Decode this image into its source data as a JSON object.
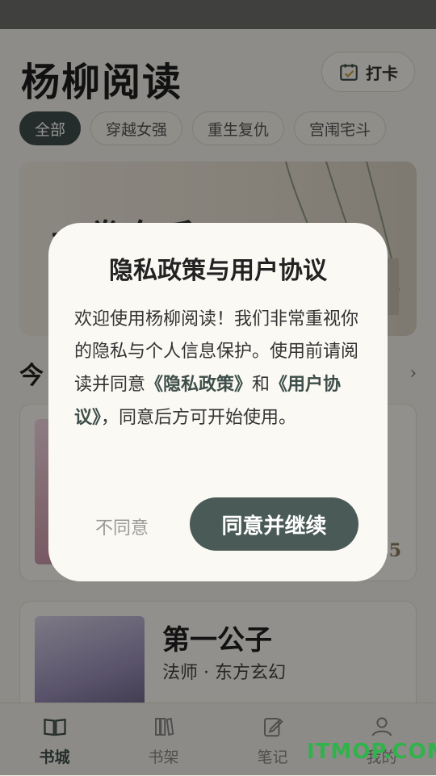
{
  "app": {
    "title": "杨柳阅读"
  },
  "checkin": {
    "label": "打卡"
  },
  "categories": [
    "全部",
    "穿越女强",
    "重生复仇",
    "宫闱宅斗"
  ],
  "banner": {
    "text": "一卷东千"
  },
  "section": {
    "title": "今"
  },
  "books": [
    {
      "title": "",
      "meta": "",
      "score": ".5"
    },
    {
      "title": "第一公子",
      "meta": "法师 · 东方玄幻"
    }
  ],
  "tabs": [
    {
      "label": "书城",
      "icon": "book-open-icon"
    },
    {
      "label": "书架",
      "icon": "bookshelf-icon"
    },
    {
      "label": "笔记",
      "icon": "note-icon"
    },
    {
      "label": "我的",
      "icon": "user-icon"
    }
  ],
  "dialog": {
    "title": "隐私政策与用户协议",
    "body_start": "欢迎使用杨柳阅读！我们非常重视你的隐私与个人信息保护。使用前请阅读并同意",
    "privacy_link": "《隐私政策》",
    "body_mid": "和",
    "terms_link": "《用户协议》",
    "body_end": "，同意后方可开始使用。",
    "disagree_label": "不同意",
    "agree_label": "同意并继续"
  },
  "watermark": "ITMOP.COM",
  "colors": {
    "accent": "#3e4e4a",
    "background": "#f5f2ea",
    "dialog": "#fbf9f4"
  }
}
